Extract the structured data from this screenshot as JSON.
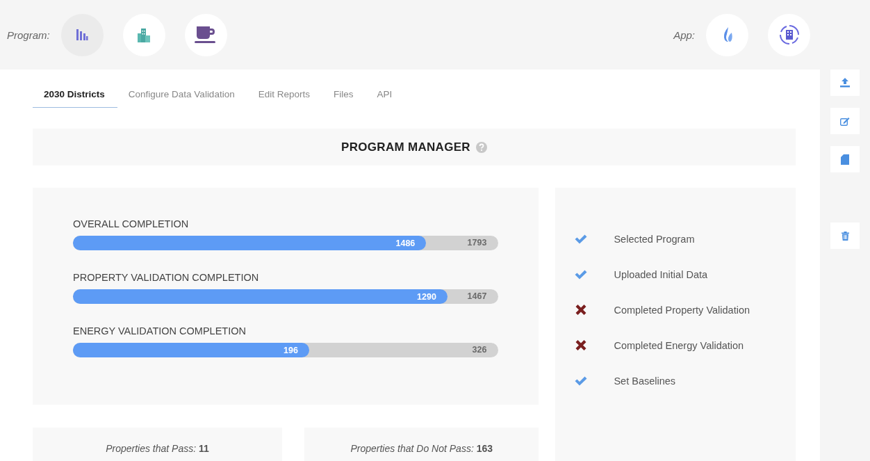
{
  "program_label": "Program:",
  "programs": [
    {
      "selected": true
    },
    {
      "selected": false
    },
    {
      "selected": false
    }
  ],
  "app_label": "App:",
  "apps": [
    {
      "selected": false
    },
    {
      "selected": false
    }
  ],
  "tabs": [
    {
      "label": "2030 Districts",
      "selected": true
    },
    {
      "label": "Configure Data Validation",
      "selected": false
    },
    {
      "label": "Edit Reports",
      "selected": false
    },
    {
      "label": "Files",
      "selected": false
    },
    {
      "label": "API",
      "selected": false
    }
  ],
  "title": "PROGRAM MANAGER",
  "progress": [
    {
      "label": "OVERALL COMPLETION",
      "level": 0.83,
      "value": "1486",
      "total": "1793"
    },
    {
      "label": "PROPERTY VALIDATION COMPLETION",
      "level": 0.88,
      "value": "1290",
      "total": "1467"
    },
    {
      "label": "ENERGY VALIDATION COMPLETION",
      "level": 0.555,
      "value": "196",
      "total": "326"
    }
  ],
  "checklist": [
    {
      "label": "Selected Program",
      "done": true
    },
    {
      "label": "Uploaded Initial Data",
      "done": true
    },
    {
      "label": "Completed Property Validation",
      "done": false
    },
    {
      "label": "Completed Energy Validation",
      "done": false
    },
    {
      "label": "Set Baselines",
      "done": true
    }
  ],
  "summary": [
    {
      "text": "*Properties that Pass:* **11**"
    },
    {
      "text": "*Properties that Do Not Pass:* **163**"
    }
  ]
}
